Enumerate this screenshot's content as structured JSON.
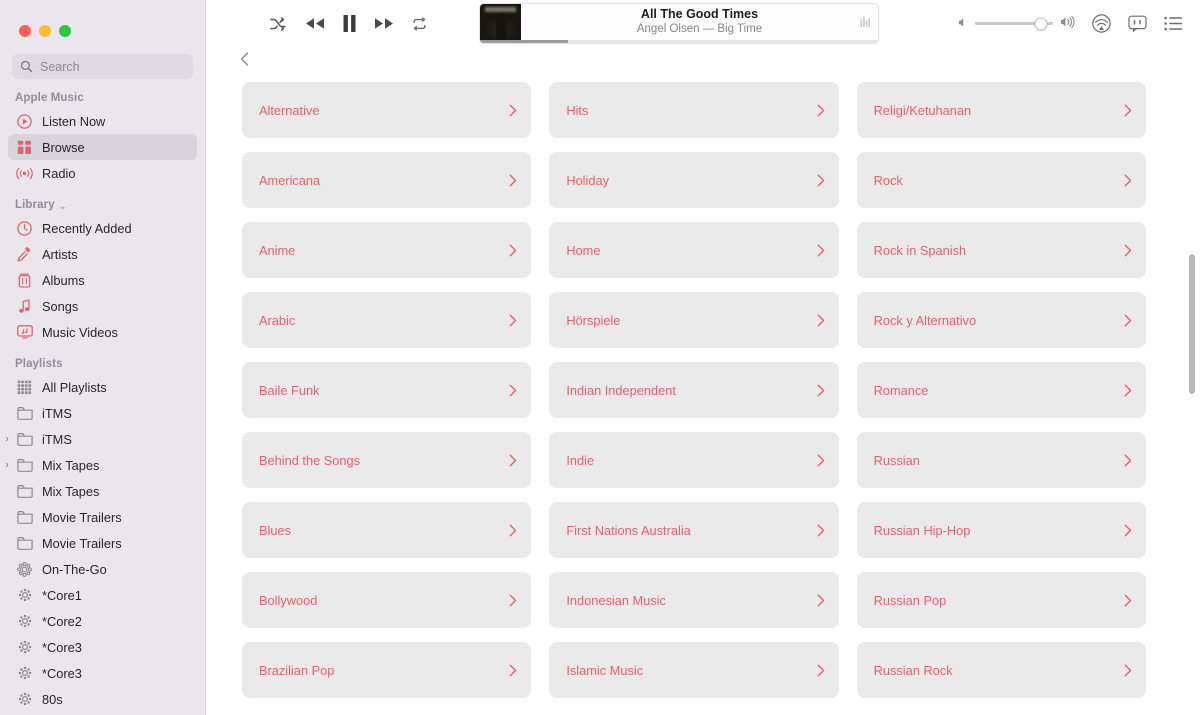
{
  "window": {
    "traffic_lights": [
      "close",
      "minimize",
      "zoom"
    ],
    "colors": {
      "close": "#ff5f57",
      "minimize": "#febc2e",
      "zoom": "#28c840",
      "accent": "#e4606d",
      "card_bg": "#ebeaea",
      "sidebar_bg": "#e9e7ec"
    }
  },
  "sidebar": {
    "search": {
      "placeholder": "Search",
      "value": "",
      "icon": "search-icon"
    },
    "sections": [
      {
        "title": "Apple Music",
        "collapsible": false,
        "items": [
          {
            "label": "Listen Now",
            "icon": "listen-now-icon",
            "selected": false,
            "disclosure": ""
          },
          {
            "label": "Browse",
            "icon": "browse-grid-icon",
            "selected": true,
            "disclosure": ""
          },
          {
            "label": "Radio",
            "icon": "radio-broadcast-icon",
            "selected": false,
            "disclosure": ""
          }
        ]
      },
      {
        "title": "Library",
        "collapsible": true,
        "chevron": "⌄",
        "items": [
          {
            "label": "Recently Added",
            "icon": "clock-icon",
            "selected": false,
            "disclosure": ""
          },
          {
            "label": "Artists",
            "icon": "microphone-icon",
            "selected": false,
            "disclosure": ""
          },
          {
            "label": "Albums",
            "icon": "album-icon",
            "selected": false,
            "disclosure": ""
          },
          {
            "label": "Songs",
            "icon": "music-note-icon",
            "selected": false,
            "disclosure": ""
          },
          {
            "label": "Music Videos",
            "icon": "music-video-icon",
            "selected": false,
            "disclosure": ""
          }
        ]
      },
      {
        "title": "Playlists",
        "collapsible": false,
        "items": [
          {
            "label": "All Playlists",
            "icon": "all-playlists-icon",
            "selected": false,
            "disclosure": ""
          },
          {
            "label": "iTMS",
            "icon": "folder-icon",
            "selected": false,
            "disclosure": ""
          },
          {
            "label": "iTMS",
            "icon": "folder-icon",
            "selected": false,
            "disclosure": "›"
          },
          {
            "label": "Mix Tapes",
            "icon": "folder-icon",
            "selected": false,
            "disclosure": "›"
          },
          {
            "label": "Mix Tapes",
            "icon": "folder-icon",
            "selected": false,
            "disclosure": ""
          },
          {
            "label": "Movie Trailers",
            "icon": "folder-icon",
            "selected": false,
            "disclosure": ""
          },
          {
            "label": "Movie Trailers",
            "icon": "folder-icon",
            "selected": false,
            "disclosure": ""
          },
          {
            "label": "On-The-Go",
            "icon": "on-the-go-icon",
            "selected": false,
            "disclosure": ""
          },
          {
            "label": "*Core1",
            "icon": "smart-playlist-icon",
            "selected": false,
            "disclosure": ""
          },
          {
            "label": "*Core2",
            "icon": "smart-playlist-icon",
            "selected": false,
            "disclosure": ""
          },
          {
            "label": "*Core3",
            "icon": "smart-playlist-icon",
            "selected": false,
            "disclosure": ""
          },
          {
            "label": "*Core3",
            "icon": "smart-playlist-icon",
            "selected": false,
            "disclosure": ""
          },
          {
            "label": "80s",
            "icon": "smart-playlist-icon",
            "selected": false,
            "disclosure": ""
          }
        ]
      }
    ]
  },
  "toolbar": {
    "transport": [
      {
        "name": "shuffle-icon",
        "label": "Shuffle",
        "active": false
      },
      {
        "name": "rewind-icon",
        "label": "Previous",
        "active": false
      },
      {
        "name": "pause-icon",
        "label": "Pause",
        "active": true
      },
      {
        "name": "fast-forward-icon",
        "label": "Next",
        "active": false
      },
      {
        "name": "repeat-icon",
        "label": "Repeat",
        "active": false
      }
    ],
    "now_playing": {
      "title": "All The Good Times",
      "subtitle": "Angel Olsen — Big Time",
      "artist": "Angel Olsen",
      "album": "Big Time",
      "progress_percent": 22,
      "artwork_alt": "Big Time album artwork",
      "eq_icon": "equalizer-icon"
    },
    "volume": {
      "level_percent": 85,
      "min_icon": "volume-min-icon",
      "max_icon": "volume-max-icon"
    },
    "right_icons": [
      {
        "name": "airplay-icon",
        "label": "AirPlay"
      },
      {
        "name": "lyrics-icon",
        "label": "Lyrics"
      },
      {
        "name": "queue-icon",
        "label": "Playing Next"
      }
    ]
  },
  "content": {
    "back_button": {
      "name": "back-chevron-icon",
      "label": "Back"
    },
    "chevron_glyph": "›",
    "genres": [
      "Alternative",
      "Hits",
      "Religi/Ketuhanan",
      "Americana",
      "Holiday",
      "Rock",
      "Anime",
      "Home",
      "Rock in Spanish",
      "Arabic",
      "Hörspiele",
      "Rock y Alternativo",
      "Baile Funk",
      "Indian Independent",
      "Romance",
      "Behind the Songs",
      "Indie",
      "Russian",
      "Blues",
      "First Nations Australia",
      "Russian Hip-Hop",
      "Bollywood",
      "Indonesian Music",
      "Russian Pop",
      "Brazilian Pop",
      "Islamic Music",
      "Russian Rock"
    ],
    "scrollbar": {
      "thumb_top_percent": 31,
      "thumb_height_percent": 21
    }
  }
}
